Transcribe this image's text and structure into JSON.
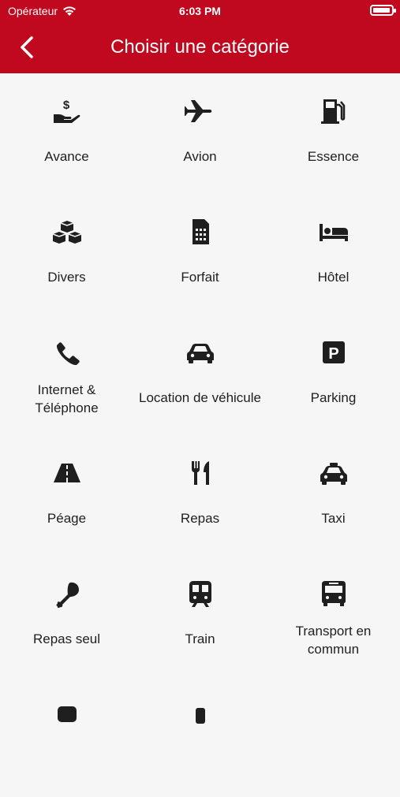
{
  "status": {
    "carrier": "Opérateur",
    "time": "6:03 PM"
  },
  "nav": {
    "title": "Choisir une catégorie"
  },
  "categories": [
    {
      "label": "Avance",
      "icon": "hand-money-icon"
    },
    {
      "label": "Avion",
      "icon": "airplane-icon"
    },
    {
      "label": "Essence",
      "icon": "fuel-pump-icon"
    },
    {
      "label": "Divers",
      "icon": "boxes-icon"
    },
    {
      "label": "Forfait",
      "icon": "sim-card-icon"
    },
    {
      "label": "Hôtel",
      "icon": "bed-icon"
    },
    {
      "label": "Internet &\nTéléphone",
      "icon": "phone-icon"
    },
    {
      "label": "Location de véhicule",
      "icon": "car-icon"
    },
    {
      "label": "Parking",
      "icon": "parking-icon"
    },
    {
      "label": "Péage",
      "icon": "road-icon"
    },
    {
      "label": "Repas",
      "icon": "utensils-icon"
    },
    {
      "label": "Taxi",
      "icon": "taxi-icon"
    },
    {
      "label": "Repas seul",
      "icon": "drumstick-icon"
    },
    {
      "label": "Train",
      "icon": "train-icon"
    },
    {
      "label": "Transport en\ncommun",
      "icon": "bus-icon"
    }
  ],
  "colors": {
    "header": "#c0081e",
    "background": "#f6f6f6",
    "icon": "#1f1f1f"
  }
}
